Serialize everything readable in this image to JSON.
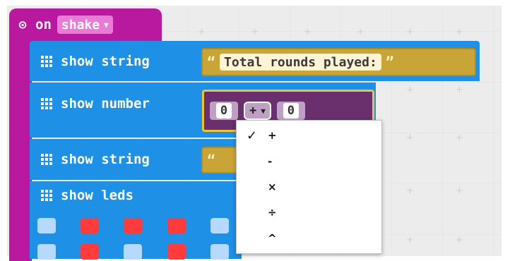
{
  "event_block": {
    "label": "on",
    "dropdown_value": "shake",
    "color": "#b8199e",
    "icon": "gear-icon"
  },
  "blocks": [
    {
      "label": "show string",
      "string_value": "Total rounds played:",
      "icon": "grid-icon"
    },
    {
      "label": "show number",
      "left_value": "0",
      "operator": "+",
      "right_value": "0",
      "icon": "grid-icon"
    },
    {
      "label": "show string",
      "icon": "grid-icon"
    },
    {
      "label": "show leds",
      "icon": "grid-icon"
    }
  ],
  "quotes": {
    "open": "“",
    "close": "”"
  },
  "leds": {
    "row1": [
      "off",
      "on",
      "on",
      "on",
      "off"
    ],
    "row2": [
      "off",
      "on",
      "off",
      "on",
      "off"
    ]
  },
  "operator_menu": {
    "items": [
      {
        "label": "+",
        "selected": true
      },
      {
        "label": "-",
        "selected": false
      },
      {
        "label": "×",
        "selected": false
      },
      {
        "label": "÷",
        "selected": false
      },
      {
        "label": "^",
        "selected": false
      }
    ],
    "check_symbol": "✓"
  },
  "colors": {
    "statement_block": "#1e90e6",
    "math_block": "#6a2f6d",
    "string_socket": "#c9a436",
    "led_on": "#ff3b3b",
    "led_off": "#b5d9ff"
  }
}
